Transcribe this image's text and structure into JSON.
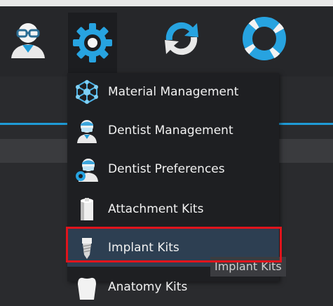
{
  "toolbar": {
    "buttons": [
      {
        "icon": "user-icon"
      },
      {
        "icon": "gear-icon"
      },
      {
        "icon": "refresh-icon"
      },
      {
        "icon": "lifebuoy-icon"
      }
    ]
  },
  "menu": {
    "items": [
      {
        "label": "Material Management",
        "icon": "material-icon"
      },
      {
        "label": "Dentist Management",
        "icon": "dentist-icon"
      },
      {
        "label": "Dentist Preferences",
        "icon": "dentist-preferences-icon"
      },
      {
        "label": "Attachment Kits",
        "icon": "attachment-kit-icon"
      },
      {
        "label": "Implant Kits",
        "icon": "implant-kit-icon"
      },
      {
        "label": "Anatomy Kits",
        "icon": "anatomy-kit-icon"
      }
    ],
    "selected_index": 4
  },
  "tooltip": {
    "text": "Implant Kits"
  },
  "colors": {
    "accent": "#1f9bd6",
    "highlight": "#e0141c",
    "menu_bg": "#1e1f22"
  }
}
